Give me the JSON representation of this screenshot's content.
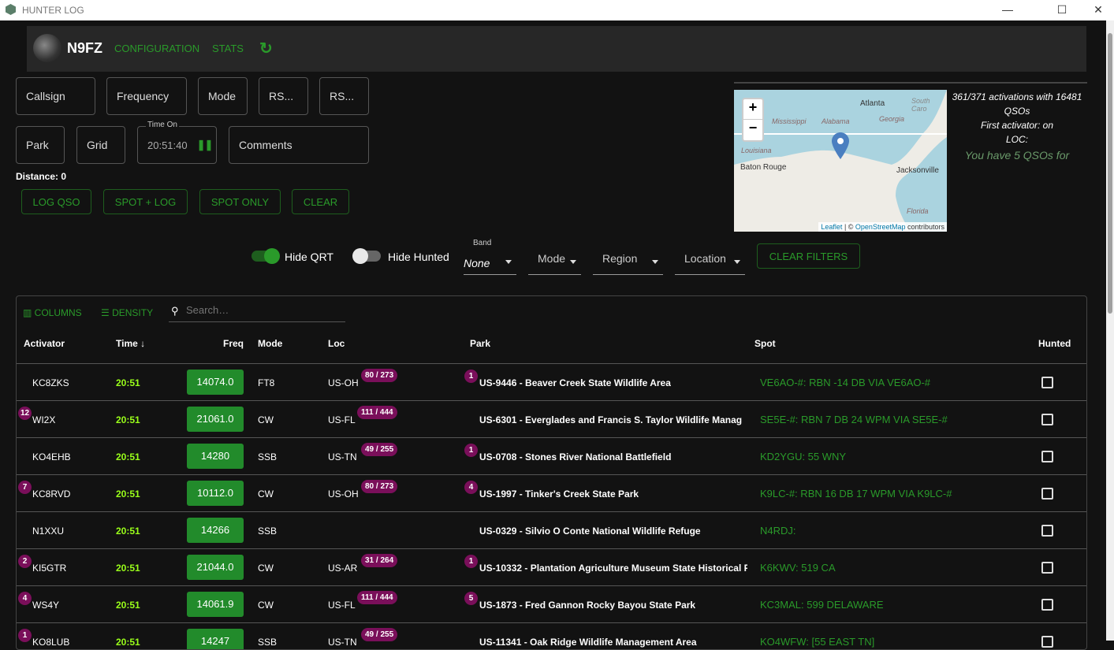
{
  "window": {
    "title": "HUNTER LOG",
    "minimize": "—",
    "maximize": "☐",
    "close": "✕"
  },
  "header": {
    "callsign": "N9FZ",
    "nav": [
      "CONFIGURATION",
      "STATS"
    ],
    "refresh_icon": "↻"
  },
  "form": {
    "callsign": "Callsign",
    "frequency": "Frequency",
    "mode": "Mode",
    "rst_sent": "RS...",
    "rst_recv": "RS...",
    "park": "Park",
    "grid": "Grid",
    "time_on_label": "Time On",
    "time_on": "20:51:40",
    "comments": "Comments",
    "distance": "Distance: 0"
  },
  "actions": [
    "LOG QSO",
    "SPOT + LOG",
    "SPOT ONLY",
    "CLEAR"
  ],
  "map": {
    "labels": [
      "Atlanta",
      "South Caro",
      "Mississippi",
      "Alabama",
      "Georgia",
      "Louisiana",
      "Baton Rouge",
      "Jacksonville",
      "Florida"
    ],
    "zoom_in": "+",
    "zoom_out": "−",
    "leaflet": "Leaflet",
    "sep": " | © ",
    "osm": "OpenStreetMap",
    "contrib": " contributors"
  },
  "info": {
    "line1": "361/371 activations with 16481 QSOs",
    "line2": "First activator: on",
    "line3": "LOC:",
    "line4": "You have 5 QSOs for"
  },
  "filters": {
    "hide_qrt": "Hide QRT",
    "hide_qrt_on": true,
    "hide_hunted": "Hide Hunted",
    "hide_hunted_on": false,
    "band_label": "Band",
    "band_value": "None",
    "mode": "Mode",
    "region": "Region",
    "location": "Location",
    "clear": "CLEAR FILTERS"
  },
  "table": {
    "columns_btn": "COLUMNS",
    "density_btn": "DENSITY",
    "search_placeholder": "Search…",
    "headers": [
      "Activator",
      "Time",
      "Freq",
      "Mode",
      "Loc",
      "Park",
      "Spot",
      "Hunted"
    ],
    "rows": [
      {
        "activator": "KC8ZKS",
        "count": "",
        "time": "20:51",
        "freq": "14074.0",
        "mode": "FT8",
        "loc": "US-OH",
        "loc_badge": "80 / 273",
        "park_badge": "1",
        "park": "US-9446 - Beaver Creek State Wildlife Area",
        "spot": "VE6AO-#: RBN -14 DB VIA VE6AO-#"
      },
      {
        "activator": "WI2X",
        "count": "12",
        "time": "20:51",
        "freq": "21061.0",
        "mode": "CW",
        "loc": "US-FL",
        "loc_badge": "111 / 444",
        "park_badge": "",
        "park": "US-6301 - Everglades and Francis S. Taylor Wildlife Manag",
        "spot": "SE5E-#: RBN 7 DB 24 WPM VIA SE5E-#"
      },
      {
        "activator": "KO4EHB",
        "count": "",
        "time": "20:51",
        "freq": "14280",
        "mode": "SSB",
        "loc": "US-TN",
        "loc_badge": "49 / 255",
        "park_badge": "1",
        "park": "US-0708 - Stones River National Battlefield",
        "spot": "KD2YGU: 55 WNY"
      },
      {
        "activator": "KC8RVD",
        "count": "7",
        "time": "20:51",
        "freq": "10112.0",
        "mode": "CW",
        "loc": "US-OH",
        "loc_badge": "80 / 273",
        "park_badge": "4",
        "park": "US-1997 - Tinker's Creek State Park",
        "spot": "K9LC-#: RBN 16 DB 17 WPM VIA K9LC-#"
      },
      {
        "activator": "N1XXU",
        "count": "",
        "time": "20:51",
        "freq": "14266",
        "mode": "SSB",
        "loc": "",
        "loc_badge": "",
        "park_badge": "",
        "park": "US-0329 - Silvio O Conte National Wildlife Refuge",
        "spot": "N4RDJ:"
      },
      {
        "activator": "KI5GTR",
        "count": "2",
        "time": "20:51",
        "freq": "21044.0",
        "mode": "CW",
        "loc": "US-AR",
        "loc_badge": "31 / 264",
        "park_badge": "1",
        "park": "US-10332 - Plantation Agriculture Museum State Historical P",
        "spot": "K6KWV: 519 CA"
      },
      {
        "activator": "WS4Y",
        "count": "4",
        "time": "20:51",
        "freq": "14061.9",
        "mode": "CW",
        "loc": "US-FL",
        "loc_badge": "111 / 444",
        "park_badge": "5",
        "park": "US-1873 - Fred Gannon Rocky Bayou State Park",
        "spot": "KC3MAL: 599 DELAWARE"
      },
      {
        "activator": "KO8LUB",
        "count": "1",
        "time": "20:51",
        "freq": "14247",
        "mode": "SSB",
        "loc": "US-TN",
        "loc_badge": "49 / 255",
        "park_badge": "",
        "park": "US-11341 - Oak Ridge Wildlife Management Area",
        "spot": "KO4WFW: [55 EAST TN]"
      }
    ]
  },
  "colors": {
    "accent": "#2a9a2a",
    "freq_bg": "#228b2b",
    "badge": "#7a0f5a",
    "time": "#9aff1a",
    "bg": "#121212"
  }
}
